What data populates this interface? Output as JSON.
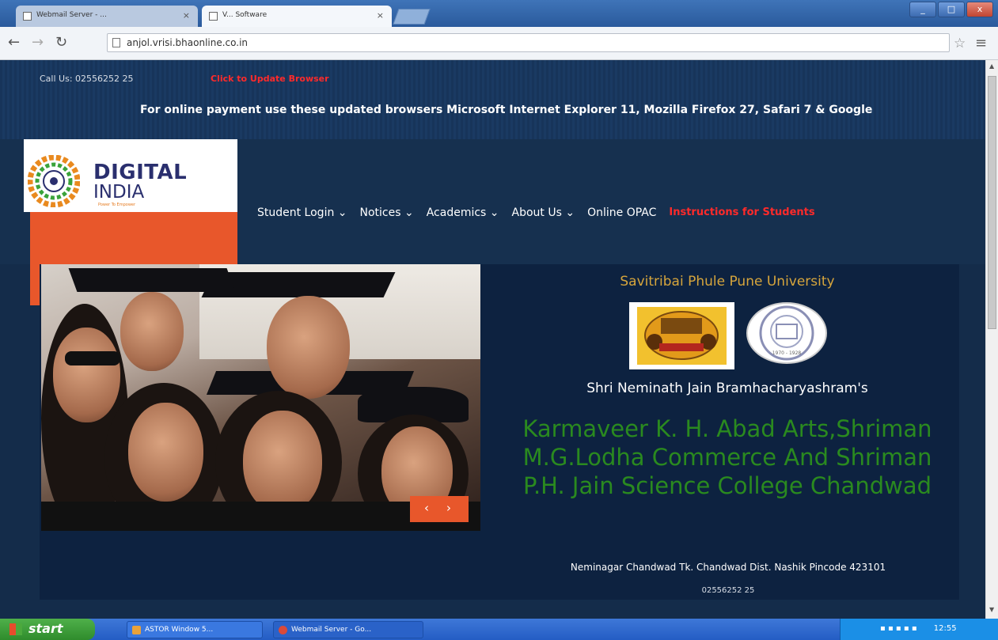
{
  "browser": {
    "tabs": [
      {
        "label": "Webmail Server - ..."
      },
      {
        "label": "V... Software"
      }
    ],
    "url": "anjol.vrisi.bhaonline.co.in",
    "window_buttons": [
      "_",
      "□",
      "x"
    ]
  },
  "topbar": {
    "call_us": "Call Us: 02556252 25",
    "update_link": "Click to Update Browser",
    "notice": "For online payment use these updated browsers Microsoft Internet Explorer 11, Mozilla Firefox 27, Safari 7 & Google"
  },
  "logo": {
    "line1": "DIGITAL",
    "line2": "INDIA",
    "tagline": "Power To Empower"
  },
  "nav": {
    "items": [
      {
        "label": "Student Login ⌄"
      },
      {
        "label": "Notices ⌄"
      },
      {
        "label": "Academics ⌄"
      },
      {
        "label": "About Us ⌄"
      },
      {
        "label": "Online OPAC"
      },
      {
        "label": "Instructions for Students"
      }
    ]
  },
  "slider": {
    "prev": "‹",
    "next": "›"
  },
  "college": {
    "university": "Savitribai Phule Pune University",
    "trust": "Shri Neminath Jain Bramhacharyashram's",
    "name": "Karmaveer K. H. Abad Arts,Shriman M.G.Lodha Commerce And Shriman P.H. Jain Science College Chandwad",
    "address": "Neminagar Chandwad Tk. Chandwad Dist. Nashik Pincode 423101",
    "phone": "02556252 25",
    "seal2_text": "1970 - 1928"
  },
  "taskbar": {
    "start": "start",
    "tasks": [
      {
        "label": "ASTOR Window 5..."
      },
      {
        "label": "Webmail Server - Go..."
      }
    ],
    "clock": "12:55"
  },
  "colors": {
    "accent_orange": "#e8572b",
    "navy": "#142c4a",
    "alert_red": "#ff2a2a",
    "college_green": "#2a8a1f",
    "university_gold": "#d6a53c"
  }
}
